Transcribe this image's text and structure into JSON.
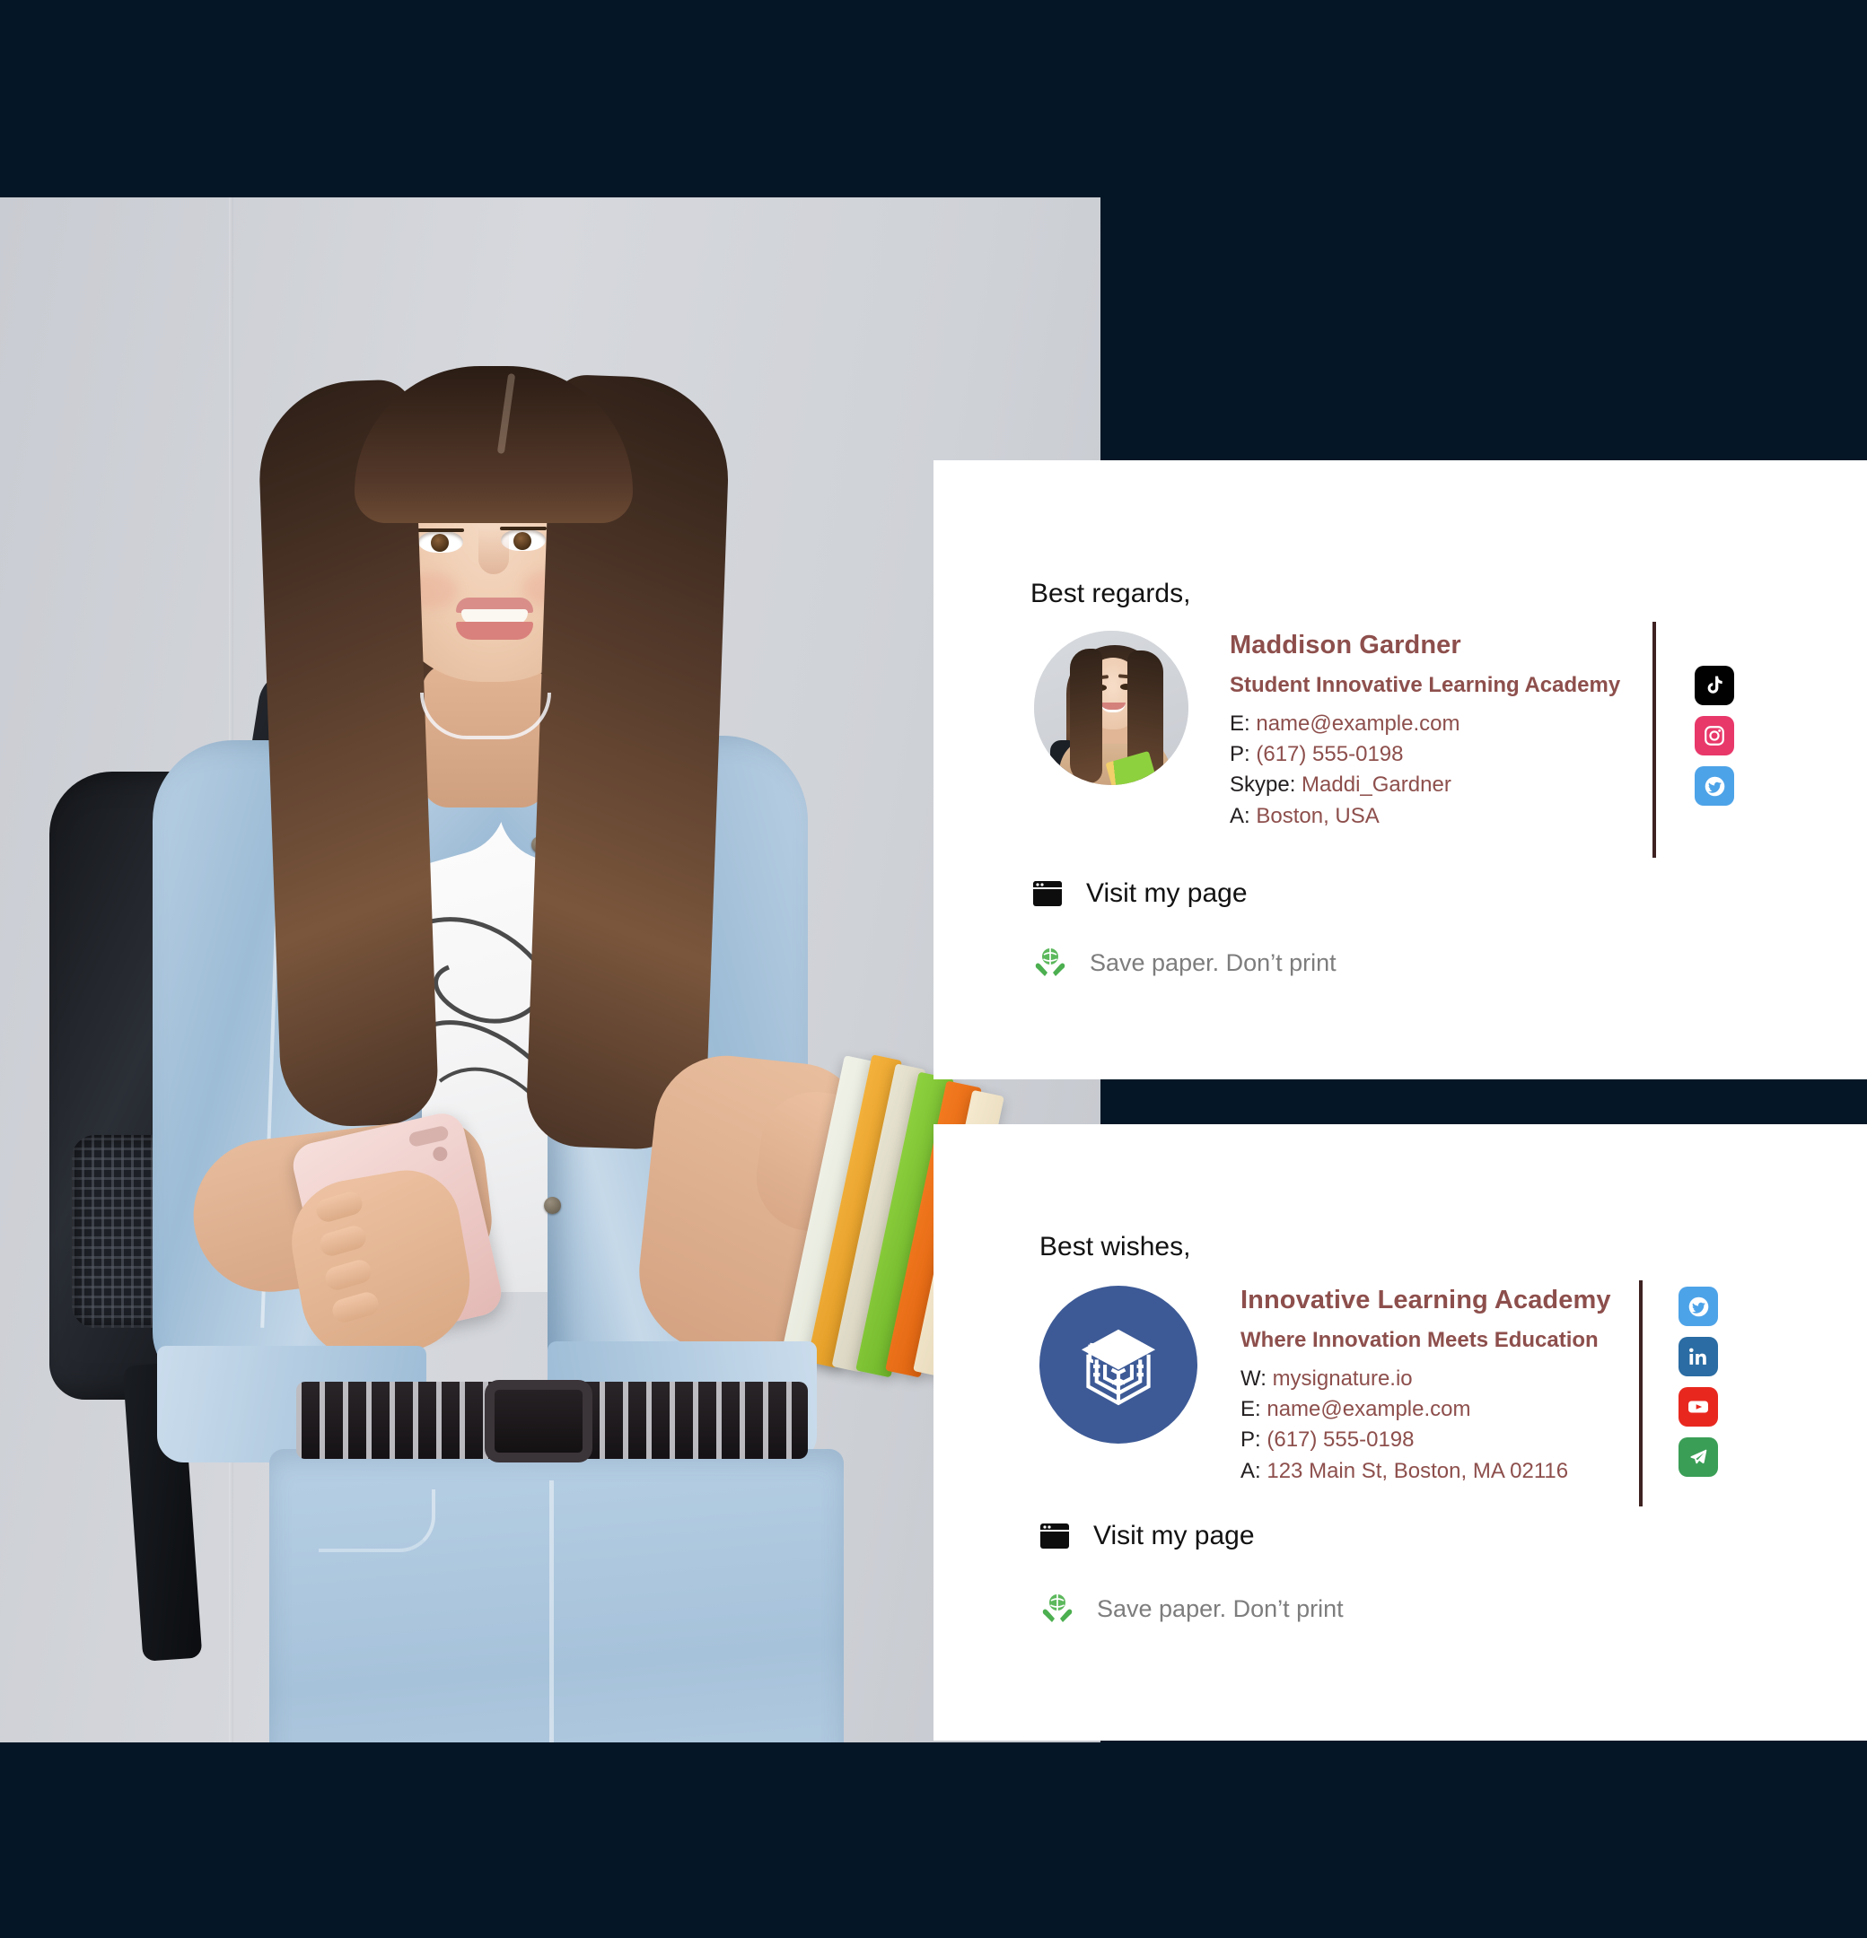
{
  "theme": {
    "background": "#051727",
    "card_background": "#ffffff",
    "accent_maroon": "#8d4f4c",
    "divider": "#3e2222",
    "muted_text": "#7d7d7d",
    "logo_blue": "#3d5a96"
  },
  "hero": {
    "alt": "Smiling female student with backpack holding a smartphone and colorful notebooks"
  },
  "signature_1": {
    "greeting": "Best regards,",
    "avatar_name": "avatar-photo-maddison",
    "name": "Maddison Gardner",
    "title": "Student Innovative Learning Academy",
    "lines": [
      {
        "label": "E:",
        "value": "name@example.com"
      },
      {
        "label": "P:",
        "value": "(617) 555-0198"
      },
      {
        "label": "Skype:",
        "value": "Maddi_Gardner"
      },
      {
        "label": "A:",
        "value": "Boston, USA"
      }
    ],
    "social": [
      {
        "name": "tiktok-icon",
        "label": "TikTok",
        "color": "#010101"
      },
      {
        "name": "instagram-icon",
        "label": "Instagram",
        "color": "#e8386a"
      },
      {
        "name": "twitter-icon",
        "label": "Twitter",
        "color": "#4da3e8"
      }
    ],
    "visit_label": "Visit my page",
    "print_label": "Save paper. Don’t print"
  },
  "signature_2": {
    "greeting": "Best wishes,",
    "logo_name": "innovative-learning-academy-logo",
    "name": "Innovative Learning Academy",
    "title": "Where Innovation Meets Education",
    "lines": [
      {
        "label": "W:",
        "value": "mysignature.io"
      },
      {
        "label": "E:",
        "value": "name@example.com"
      },
      {
        "label": "P:",
        "value": "(617) 555-0198"
      },
      {
        "label": "A:",
        "value": "123 Main St, Boston, MA 02116"
      }
    ],
    "social": [
      {
        "name": "twitter-icon",
        "label": "Twitter",
        "color": "#4da3e8"
      },
      {
        "name": "linkedin-icon",
        "label": "LinkedIn",
        "color": "#2a6ca3"
      },
      {
        "name": "youtube-icon",
        "label": "YouTube",
        "color": "#e8281f"
      },
      {
        "name": "telegram-icon",
        "label": "Telegram",
        "color": "#3a9e56"
      }
    ],
    "visit_label": "Visit my page",
    "print_label": "Save paper. Don’t print"
  }
}
